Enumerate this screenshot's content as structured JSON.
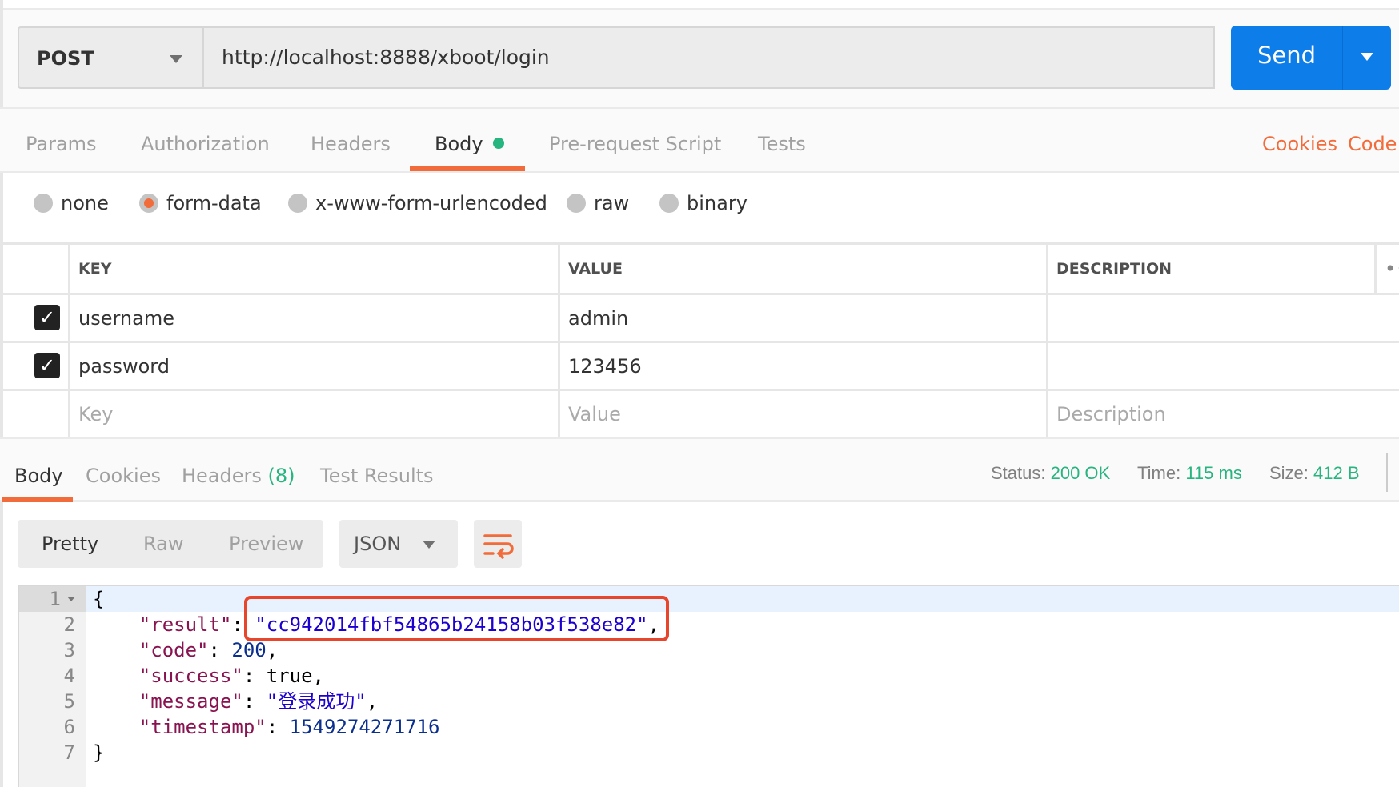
{
  "request": {
    "method": "POST",
    "url": "http://localhost:8888/xboot/login",
    "send_label": "Send"
  },
  "tabs": [
    {
      "label": "Params"
    },
    {
      "label": "Authorization"
    },
    {
      "label": "Headers"
    },
    {
      "label": "Body",
      "active": true
    },
    {
      "label": "Pre-request Script"
    },
    {
      "label": "Tests"
    }
  ],
  "links": {
    "cookies": "Cookies",
    "code": "Code"
  },
  "body_types": [
    {
      "label": "none"
    },
    {
      "label": "form-data",
      "selected": true
    },
    {
      "label": "x-www-form-urlencoded"
    },
    {
      "label": "raw"
    },
    {
      "label": "binary"
    }
  ],
  "table": {
    "headers": {
      "key": "KEY",
      "value": "VALUE",
      "description": "DESCRIPTION"
    },
    "rows": [
      {
        "checked": true,
        "key": "username",
        "value": "admin",
        "description": ""
      },
      {
        "checked": true,
        "key": "password",
        "value": "123456",
        "description": ""
      }
    ],
    "placeholders": {
      "key": "Key",
      "value": "Value",
      "description": "Description"
    }
  },
  "response": {
    "tabs": [
      {
        "label": "Body",
        "active": true
      },
      {
        "label": "Cookies"
      },
      {
        "label": "Headers"
      },
      {
        "label": "Test Results"
      }
    ],
    "headers_count": "(8)",
    "status_label": "Status:",
    "status": "200 OK",
    "time_label": "Time:",
    "time": "115 ms",
    "size_label": "Size:",
    "size": "412 B",
    "views": {
      "pretty": "Pretty",
      "raw": "Raw",
      "preview": "Preview"
    },
    "format": "JSON",
    "code": {
      "l1": "{",
      "k_result": "\"result\"",
      "v_result": "\"cc942014fbf54865b24158b03f538e82\"",
      "k_code": "\"code\"",
      "v_code": "200",
      "k_success": "\"success\"",
      "v_success": "true",
      "k_message": "\"message\"",
      "v_message": "\"登录成功\"",
      "k_timestamp": "\"timestamp\"",
      "v_timestamp": "1549274271716",
      "l7": "}"
    },
    "line_numbers": [
      "1",
      "2",
      "3",
      "4",
      "5",
      "6",
      "7"
    ]
  },
  "colors": {
    "accent": "#f26b3a",
    "send": "#0d7de9",
    "success": "#26b47f",
    "highlight_box": "#e8462c"
  }
}
